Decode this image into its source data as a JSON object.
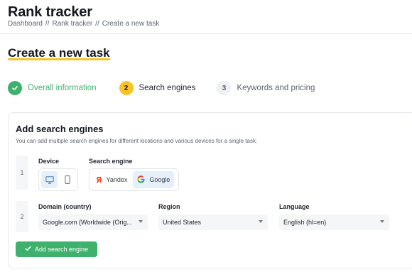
{
  "header": {
    "title": "Rank tracker",
    "breadcrumb": [
      "Dashboard",
      "Rank tracker",
      "Create a new task"
    ],
    "separator": "//"
  },
  "page_title": "Create a new task",
  "stepper": [
    {
      "number": "1",
      "label": "Overall information",
      "state": "done"
    },
    {
      "number": "2",
      "label": "Search engines",
      "state": "active"
    },
    {
      "number": "3",
      "label": "Keywords and pricing",
      "state": "todo"
    }
  ],
  "card": {
    "title": "Add search engines",
    "description": "You can add multiple search engines for different locations and various devices for a single task.",
    "rows": [
      {
        "number": "1",
        "device_label": "Device",
        "engine_label": "Search engine",
        "devices": [
          {
            "icon": "desktop-icon",
            "selected": true
          },
          {
            "icon": "mobile-icon",
            "selected": false
          }
        ],
        "engines": [
          {
            "label": "Yandex",
            "icon": "yandex-logo",
            "selected": false
          },
          {
            "label": "Google",
            "icon": "google-logo",
            "selected": true
          }
        ]
      },
      {
        "number": "2",
        "domain_label": "Domain (country)",
        "domain_value": "Google.com (Worldwide (Orig...",
        "region_label": "Region",
        "region_value": "United States",
        "language_label": "Language",
        "language_value": "English (hl=en)"
      }
    ],
    "add_button": "Add search engine"
  },
  "colors": {
    "accent_green": "#3fb16d",
    "accent_yellow": "#f7c325",
    "selected_blue_bg": "#e6f0fb",
    "yandex_red": "#fc3f1d"
  }
}
